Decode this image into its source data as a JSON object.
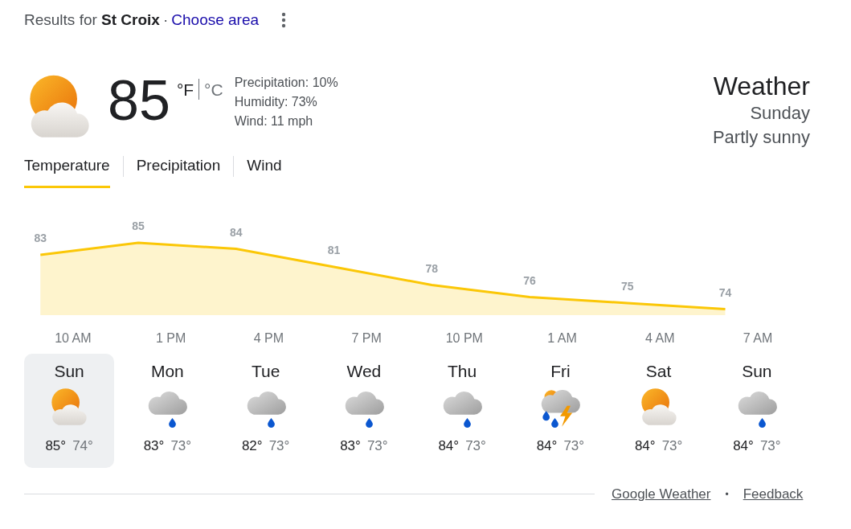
{
  "header": {
    "prefix": "Results for ",
    "place": "St Croix",
    "separator": "·",
    "link": "Choose area"
  },
  "current": {
    "kind": "partly_sunny",
    "temperature": "85",
    "units": [
      {
        "label": "°F",
        "selected": true
      },
      {
        "label": "°C",
        "selected": false
      }
    ],
    "details": [
      "Precipitation: 10%",
      "Humidity: 73%",
      "Wind: 11 mph"
    ],
    "title": "Weather",
    "day": "Sunday",
    "condition": "Partly sunny"
  },
  "tabs": [
    {
      "label": "Temperature",
      "selected": true
    },
    {
      "label": "Precipitation",
      "selected": false
    },
    {
      "label": "Wind",
      "selected": false
    }
  ],
  "chart_data": {
    "type": "area",
    "categories": [
      null,
      "10 AM",
      null,
      null,
      "1 PM",
      null,
      null,
      "4 PM",
      null,
      null,
      "7 PM",
      null,
      null,
      "10 PM",
      null,
      null,
      "1 AM",
      null,
      null,
      "4 AM",
      null,
      null,
      "7 AM",
      null
    ],
    "series": [
      {
        "color": "#fbc707",
        "values": [
          83,
          null,
          null,
          85,
          null,
          null,
          84,
          null,
          null,
          81,
          null,
          null,
          78,
          null,
          null,
          76,
          null,
          null,
          75,
          null,
          null,
          74,
          null,
          null
        ]
      }
    ],
    "data_labels": true
  },
  "days": [
    {
      "day": "Sun",
      "kind": "partly_sunny",
      "high": "85°",
      "low": "74°",
      "selected": true
    },
    {
      "day": "Mon",
      "kind": "rain",
      "high": "83°",
      "low": "73°",
      "selected": false
    },
    {
      "day": "Tue",
      "kind": "rain",
      "high": "82°",
      "low": "73°",
      "selected": false
    },
    {
      "day": "Wed",
      "kind": "rain",
      "high": "83°",
      "low": "73°",
      "selected": false
    },
    {
      "day": "Thu",
      "kind": "rain",
      "high": "84°",
      "low": "73°",
      "selected": false
    },
    {
      "day": "Fri",
      "kind": "storm",
      "high": "84°",
      "low": "73°",
      "selected": false
    },
    {
      "day": "Sat",
      "kind": "partly_sunny",
      "high": "84°",
      "low": "73°",
      "selected": false
    },
    {
      "day": "Sun",
      "kind": "rain",
      "high": "84°",
      "low": "73°",
      "selected": false
    }
  ],
  "footer": {
    "links": [
      "Google Weather",
      "Feedback"
    ],
    "separator": "•"
  }
}
